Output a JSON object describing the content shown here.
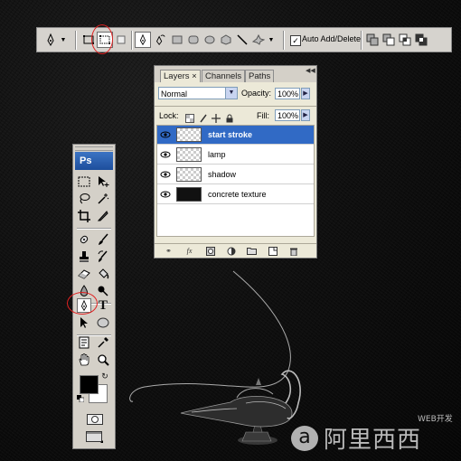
{
  "options_bar": {
    "auto_add_delete_label": "Auto Add/Delete",
    "auto_add_delete_checked": true,
    "checkbox_mark": "✓"
  },
  "layers_panel": {
    "tabs": [
      {
        "label": "Layers",
        "close": "×"
      },
      {
        "label": "Channels"
      },
      {
        "label": "Paths"
      }
    ],
    "blend_mode": "Normal",
    "opacity_label": "Opacity:",
    "opacity_value": "100%",
    "lock_label": "Lock:",
    "fill_label": "Fill:",
    "fill_value": "100%",
    "layers": [
      {
        "name": "start stroke",
        "selected": true
      },
      {
        "name": "lamp"
      },
      {
        "name": "shadow"
      },
      {
        "name": "concrete texture"
      }
    ]
  },
  "tools_panel": {
    "logo_text": "Ps",
    "type_tool_glyph": "T"
  },
  "watermark": {
    "small": "WEB开发",
    "large": "阿里西西"
  },
  "colors": {
    "selection_highlight": "#316ac5",
    "annotation_red": "#e02020"
  }
}
